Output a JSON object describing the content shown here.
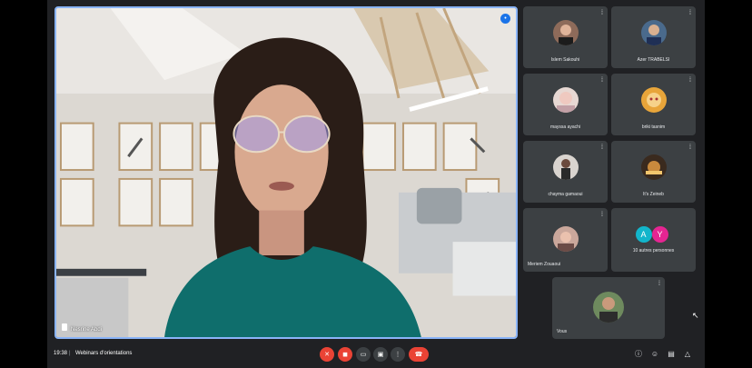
{
  "main": {
    "speaker_name": "Nesrine Abdi"
  },
  "tiles": [
    {
      "name": "Islem Sakouhi",
      "muted": true
    },
    {
      "name": "Azer TRABELSI",
      "muted": true
    },
    {
      "name": "mayssa ayachi",
      "muted": true
    },
    {
      "name": "briki tasnim",
      "muted": true
    },
    {
      "name": "chayma gamaoui",
      "muted": true
    },
    {
      "name": "It's Zeineb",
      "muted": true
    },
    {
      "name": "Meriem Zouaoui",
      "muted": true
    }
  ],
  "others": {
    "initials": [
      "A",
      "Y"
    ],
    "colors": [
      "#12b5cb",
      "#e52592"
    ],
    "label": "10 autres personnes"
  },
  "self_tile": {
    "name": "Vous",
    "muted": true
  },
  "bottombar": {
    "time": "19:38",
    "separator": "|",
    "meeting_title": "Webinars d'orientations",
    "controls": [
      "mic-off-icon",
      "camera-off-icon",
      "captions-icon",
      "present-icon",
      "more-icon",
      "hang-up-icon"
    ],
    "right_controls": [
      "info-icon",
      "people-icon",
      "chat-icon",
      "activities-icon"
    ]
  },
  "mute_glyph": "⁞"
}
